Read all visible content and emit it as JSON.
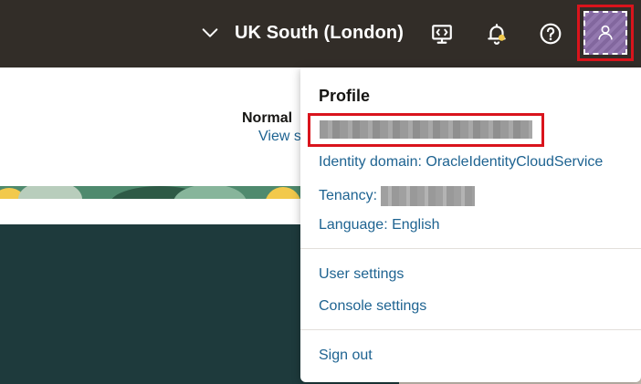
{
  "header": {
    "region_label": "UK South (London)",
    "icons": {
      "region_dropdown": "chevron-down-icon",
      "cloud_shell": "cloud-shell-icon",
      "notifications": "bell-icon",
      "help": "help-icon",
      "profile": "user-icon"
    }
  },
  "page": {
    "normal_label": "Normal",
    "view_link": "View s"
  },
  "profile_menu": {
    "title": "Profile",
    "identity_domain": "Identity domain: OracleIdentityCloudService",
    "tenancy_label": "Tenancy:",
    "language": "Language: English",
    "user_settings": "User settings",
    "console_settings": "Console settings",
    "sign_out": "Sign out"
  },
  "colors": {
    "topbar": "#322d28",
    "link": "#1e6391",
    "highlight": "#d9141c",
    "avatar": "#8a6da8",
    "dark_section": "#1e3a3c"
  }
}
